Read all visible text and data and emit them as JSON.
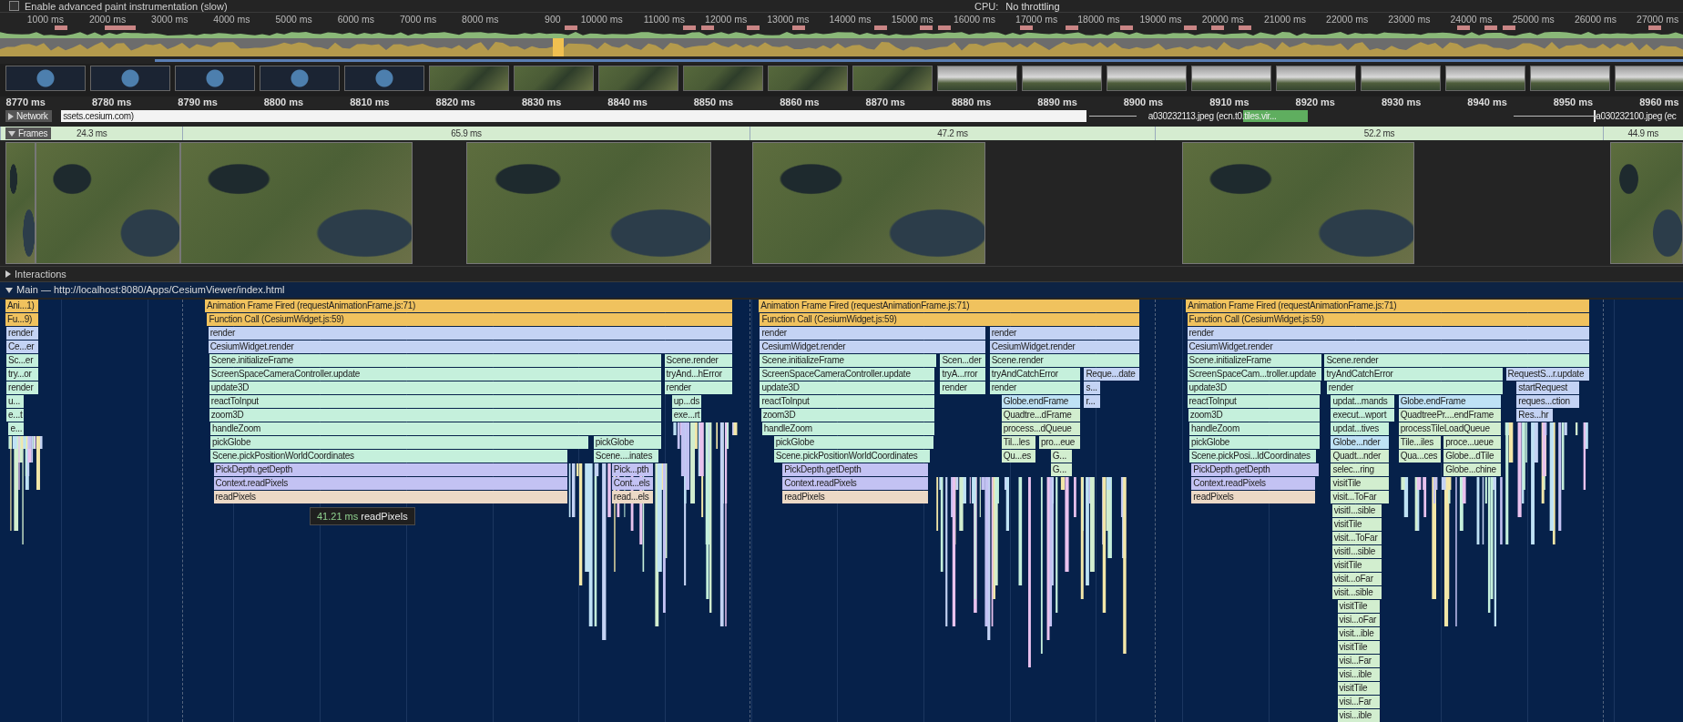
{
  "toolbar": {
    "paint_checkbox": {
      "label": "Enable advanced paint instrumentation (slow)",
      "checked": false
    },
    "cpu_label": "CPU:",
    "cpu_throttling": "No throttling"
  },
  "overview": {
    "ticks": [
      "1000 ms",
      "2000 ms",
      "3000 ms",
      "4000 ms",
      "5000 ms",
      "6000 ms",
      "7000 ms",
      "8000 ms",
      "900",
      "10000 ms",
      "11000 ms",
      "12000 ms",
      "13000 ms",
      "14000 ms",
      "15000 ms",
      "16000 ms",
      "17000 ms",
      "18000 ms",
      "19000 ms",
      "20000 ms",
      "21000 ms",
      "22000 ms",
      "23000 ms",
      "24000 ms",
      "25000 ms",
      "26000 ms",
      "27000 ms"
    ]
  },
  "ruler": {
    "ticks": [
      "8770 ms",
      "8780 ms",
      "8790 ms",
      "8800 ms",
      "8810 ms",
      "8820 ms",
      "8830 ms",
      "8840 ms",
      "8850 ms",
      "8860 ms",
      "8870 ms",
      "8880 ms",
      "8890 ms",
      "8900 ms",
      "8910 ms",
      "8920 ms",
      "8930 ms",
      "8940 ms",
      "8950 ms",
      "8960 ms"
    ]
  },
  "network": {
    "label": "Network",
    "expanded": false,
    "requests": [
      "ssets.cesium.com)",
      "a030232113.jpeg (ecn.t0.tiles.vir...",
      "a030232100.jpeg (ec"
    ]
  },
  "frames": {
    "label": "Frames",
    "expanded": true,
    "durations": [
      "24.3 ms",
      "65.9 ms",
      "47.2 ms",
      "52.2 ms",
      "44.9 ms"
    ]
  },
  "interactions": {
    "label": "Interactions",
    "expanded": false
  },
  "main": {
    "title": "Main — http://localhost:8080/Apps/CesiumViewer/index.html",
    "expanded": true,
    "blocks": [
      {
        "label": "Ani...1)",
        "kind": "task"
      },
      {
        "label": "Fu...9)",
        "kind": "task"
      },
      {
        "label": "render",
        "kind": "render"
      },
      {
        "label": "Ce...er",
        "kind": "render"
      },
      {
        "label": "Sc...er",
        "kind": "scene"
      },
      {
        "label": "try...or",
        "kind": "scene"
      },
      {
        "label": "render",
        "kind": "scene"
      },
      {
        "label": "u...",
        "kind": "scene"
      },
      {
        "label": "e...t",
        "kind": "scene"
      },
      {
        "label": "e...",
        "kind": "scene"
      },
      {
        "label": "Animation Frame Fired (requestAnimationFrame.js:71)",
        "kind": "task"
      },
      {
        "label": "Function Call (CesiumWidget.js:59)",
        "kind": "task"
      },
      {
        "label": "render",
        "kind": "render"
      },
      {
        "label": "CesiumWidget.render",
        "kind": "render"
      },
      {
        "label": "Scene.initializeFrame",
        "kind": "scene"
      },
      {
        "label": "Scene.render",
        "kind": "scene"
      },
      {
        "label": "ScreenSpaceCameraController.update",
        "kind": "scene"
      },
      {
        "label": "tryAnd...hError",
        "kind": "scene"
      },
      {
        "label": "update3D",
        "kind": "scene"
      },
      {
        "label": "render",
        "kind": "scene"
      },
      {
        "label": "reactToInput",
        "kind": "scene"
      },
      {
        "label": "up...ds",
        "kind": "scene"
      },
      {
        "label": "zoom3D",
        "kind": "scene"
      },
      {
        "label": "exe...rt",
        "kind": "scene"
      },
      {
        "label": "handleZoom",
        "kind": "scene"
      },
      {
        "label": "pickGlobe",
        "kind": "scene"
      },
      {
        "label": "pickGlobe",
        "kind": "scene"
      },
      {
        "label": "Scene.pickPositionWorldCoordinates",
        "kind": "scene"
      },
      {
        "label": "Scene....inates",
        "kind": "scene"
      },
      {
        "label": "PickDepth.getDepth",
        "kind": "depth"
      },
      {
        "label": "Pick...pth",
        "kind": "depth"
      },
      {
        "label": "Context.readPixels",
        "kind": "depth"
      },
      {
        "label": "Cont...els",
        "kind": "depth"
      },
      {
        "label": "readPixels",
        "kind": "pixels"
      },
      {
        "label": "read...els",
        "kind": "pixels"
      },
      {
        "label": "Animation Frame Fired (requestAnimationFrame.js:71)",
        "kind": "task"
      },
      {
        "label": "Function Call (CesiumWidget.js:59)",
        "kind": "task"
      },
      {
        "label": "render",
        "kind": "render"
      },
      {
        "label": "render",
        "kind": "render"
      },
      {
        "label": "CesiumWidget.render",
        "kind": "render"
      },
      {
        "label": "CesiumWidget.render",
        "kind": "render"
      },
      {
        "label": "Scene.initializeFrame",
        "kind": "scene"
      },
      {
        "label": "Scen...der",
        "kind": "scene"
      },
      {
        "label": "Scene.render",
        "kind": "scene"
      },
      {
        "label": "ScreenSpaceCameraController.update",
        "kind": "scene"
      },
      {
        "label": "tryA...rror",
        "kind": "scene"
      },
      {
        "label": "tryAndCatchError",
        "kind": "scene"
      },
      {
        "label": "Reque...date",
        "kind": "render"
      },
      {
        "label": "update3D",
        "kind": "scene"
      },
      {
        "label": "render",
        "kind": "scene"
      },
      {
        "label": "render",
        "kind": "scene"
      },
      {
        "label": "s...",
        "kind": "render"
      },
      {
        "label": "reactToInput",
        "kind": "scene"
      },
      {
        "label": "Globe.endFrame",
        "kind": "globe"
      },
      {
        "label": "r...",
        "kind": "render"
      },
      {
        "label": "zoom3D",
        "kind": "scene"
      },
      {
        "label": "Quadtre...dFrame",
        "kind": "tile"
      },
      {
        "label": "handleZoom",
        "kind": "scene"
      },
      {
        "label": "process...dQueue",
        "kind": "tile"
      },
      {
        "label": "pickGlobe",
        "kind": "scene"
      },
      {
        "label": "Til...les",
        "kind": "tile"
      },
      {
        "label": "pro...eue",
        "kind": "tile"
      },
      {
        "label": "Scene.pickPositionWorldCoordinates",
        "kind": "scene"
      },
      {
        "label": "Qu...es",
        "kind": "tile"
      },
      {
        "label": "G...",
        "kind": "tile"
      },
      {
        "label": "PickDepth.getDepth",
        "kind": "depth"
      },
      {
        "label": "G...",
        "kind": "tile"
      },
      {
        "label": "Context.readPixels",
        "kind": "depth"
      },
      {
        "label": "readPixels",
        "kind": "pixels"
      },
      {
        "label": "Animation Frame Fired (requestAnimationFrame.js:71)",
        "kind": "task"
      },
      {
        "label": "Function Call (CesiumWidget.js:59)",
        "kind": "task"
      },
      {
        "label": "render",
        "kind": "render"
      },
      {
        "label": "CesiumWidget.render",
        "kind": "render"
      },
      {
        "label": "Scene.initializeFrame",
        "kind": "scene"
      },
      {
        "label": "Scene.render",
        "kind": "scene"
      },
      {
        "label": "ScreenSpaceCam...troller.update",
        "kind": "scene"
      },
      {
        "label": "tryAndCatchError",
        "kind": "scene"
      },
      {
        "label": "RequestS...r.update",
        "kind": "render"
      },
      {
        "label": "update3D",
        "kind": "scene"
      },
      {
        "label": "render",
        "kind": "scene"
      },
      {
        "label": "startRequest",
        "kind": "render"
      },
      {
        "label": "reactToInput",
        "kind": "scene"
      },
      {
        "label": "updat...mands",
        "kind": "scene"
      },
      {
        "label": "Globe.endFrame",
        "kind": "globe"
      },
      {
        "label": "reques...ction",
        "kind": "render"
      },
      {
        "label": "zoom3D",
        "kind": "scene"
      },
      {
        "label": "execut...wport",
        "kind": "scene"
      },
      {
        "label": "QuadtreePr....endFrame",
        "kind": "tile"
      },
      {
        "label": "Res...hr",
        "kind": "render"
      },
      {
        "label": "handleZoom",
        "kind": "scene"
      },
      {
        "label": "updat...tives",
        "kind": "scene"
      },
      {
        "label": "processTileLoadQueue",
        "kind": "tile"
      },
      {
        "label": "pickGlobe",
        "kind": "scene"
      },
      {
        "label": "Globe...nder",
        "kind": "globe"
      },
      {
        "label": "Tile...iles",
        "kind": "tile"
      },
      {
        "label": "proce...ueue",
        "kind": "tile"
      },
      {
        "label": "Scene.pickPosi...ldCoordinates",
        "kind": "scene"
      },
      {
        "label": "Quadt...nder",
        "kind": "tile"
      },
      {
        "label": "Qua...ces",
        "kind": "tile"
      },
      {
        "label": "Globe...dTile",
        "kind": "tile"
      },
      {
        "label": "PickDepth.getDepth",
        "kind": "depth"
      },
      {
        "label": "selec...ring",
        "kind": "tile"
      },
      {
        "label": "Globe...chine",
        "kind": "tile"
      },
      {
        "label": "Context.readPixels",
        "kind": "depth"
      },
      {
        "label": "visitTile",
        "kind": "tile"
      },
      {
        "label": "readPixels",
        "kind": "pixels"
      },
      {
        "label": "visit...ToFar",
        "kind": "tile"
      },
      {
        "label": "visitI...sible",
        "kind": "tile"
      },
      {
        "label": "visitTile",
        "kind": "tile"
      },
      {
        "label": "visit...ToFar",
        "kind": "tile"
      },
      {
        "label": "visitI...sible",
        "kind": "tile"
      },
      {
        "label": "visitTile",
        "kind": "tile"
      },
      {
        "label": "visit...oFar",
        "kind": "tile"
      },
      {
        "label": "visit...sible",
        "kind": "tile"
      },
      {
        "label": "visitTile",
        "kind": "tile"
      },
      {
        "label": "visi...oFar",
        "kind": "tile"
      },
      {
        "label": "visit...ible",
        "kind": "tile"
      },
      {
        "label": "visitTile",
        "kind": "tile"
      },
      {
        "label": "visi...Far",
        "kind": "tile"
      },
      {
        "label": "visi...ible",
        "kind": "tile"
      },
      {
        "label": "visitTile",
        "kind": "tile"
      },
      {
        "label": "visi...Far",
        "kind": "tile"
      },
      {
        "label": "visi...ible",
        "kind": "tile"
      }
    ],
    "tooltip": {
      "time": "41.21 ms",
      "label": "readPixels"
    }
  }
}
